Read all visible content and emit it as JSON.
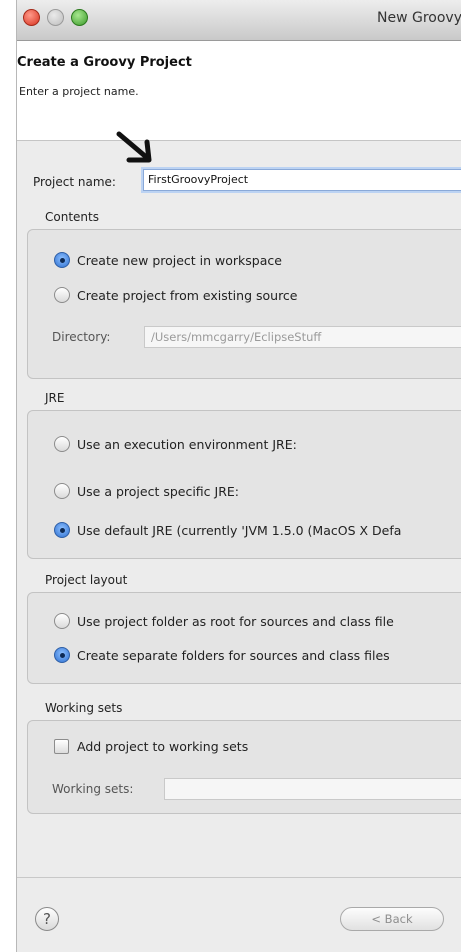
{
  "window": {
    "title": "New Groovy"
  },
  "header": {
    "title": "Create a Groovy Project",
    "description": "Enter a project name."
  },
  "project": {
    "name_label": "Project name:",
    "name_value": "FirstGroovyProject"
  },
  "contents": {
    "title": "Contents",
    "options": [
      {
        "label": "Create new project in workspace",
        "selected": true
      },
      {
        "label": "Create project from existing source",
        "selected": false
      }
    ],
    "directory_label": "Directory:",
    "directory_value": "/Users/mmcgarry/EclipseStuff"
  },
  "jre": {
    "title": "JRE",
    "options": [
      {
        "label": "Use an execution environment JRE:",
        "selected": false
      },
      {
        "label": "Use a project specific JRE:",
        "selected": false
      },
      {
        "label": "Use default JRE (currently 'JVM 1.5.0 (MacOS X Defa",
        "selected": true
      }
    ]
  },
  "layout": {
    "title": "Project layout",
    "options": [
      {
        "label": "Use project folder as root for sources and class file",
        "selected": false
      },
      {
        "label": "Create separate folders for sources and class files",
        "selected": true
      }
    ]
  },
  "working_sets": {
    "title": "Working sets",
    "add_label": "Add project to working sets",
    "add_checked": false,
    "sets_label": "Working sets:",
    "sets_value": ""
  },
  "footer": {
    "help_symbol": "?",
    "back_label": "< Back"
  },
  "colors": {
    "accent": "#2c6fd1",
    "window_bg": "#ececec"
  }
}
